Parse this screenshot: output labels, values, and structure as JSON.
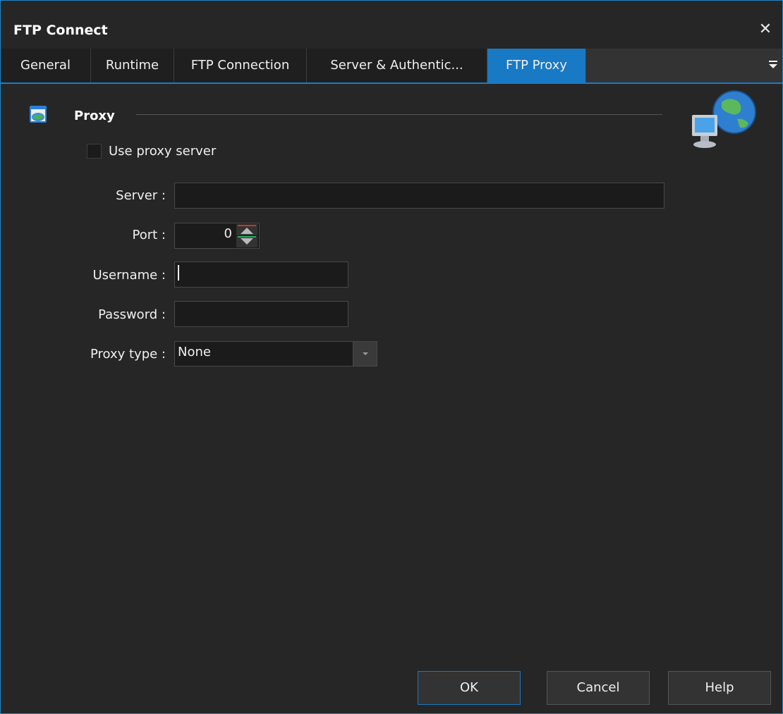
{
  "window": {
    "title": "FTP Connect",
    "close_icon": "close-icon"
  },
  "tabs": [
    {
      "label": "General",
      "active": false
    },
    {
      "label": "Runtime",
      "active": false
    },
    {
      "label": "FTP Connection",
      "active": false
    },
    {
      "label": "Server & Authentic...",
      "active": false
    },
    {
      "label": "FTP Proxy",
      "active": true
    }
  ],
  "tab_menu_icon": "overflow-menu-icon",
  "proxy": {
    "group_title": "Proxy",
    "group_icon": "proxy-window-icon",
    "decor_icon": "network-globe-icon",
    "use_proxy_label": "Use proxy server",
    "use_proxy_checked": false,
    "server_label": "Server :",
    "server_value": "",
    "port_label": "Port :",
    "port_value": "0",
    "username_label": "Username :",
    "username_value": "",
    "password_label": "Password :",
    "password_value": "",
    "proxy_type_label": "Proxy type :",
    "proxy_type_value": "None"
  },
  "buttons": {
    "ok": "OK",
    "cancel": "Cancel",
    "help": "Help"
  },
  "colors": {
    "accent": "#1879c4",
    "background": "#262626",
    "input_background": "#1b1b1b"
  }
}
